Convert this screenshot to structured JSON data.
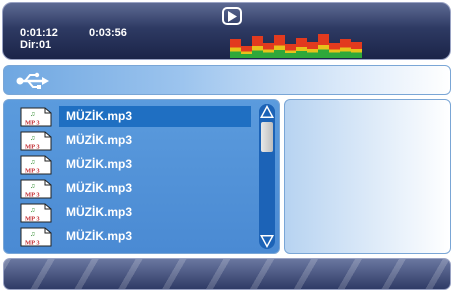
{
  "player": {
    "elapsed": "0:01:12",
    "total": "0:03:56",
    "dir": "Dir:01",
    "play_icon": "play-icon",
    "eq_levels": [
      0.7,
      0.45,
      0.8,
      0.55,
      0.85,
      0.5,
      0.75,
      0.6,
      0.9,
      0.55,
      0.7,
      0.6
    ]
  },
  "path_bar": {
    "icon": "usb-icon"
  },
  "file_list": {
    "items": [
      {
        "label": "MÜZİK.mp3",
        "icon": "mp3-file-icon",
        "icon_text": "MP 3",
        "selected": true
      },
      {
        "label": "MÜZİK.mp3",
        "icon": "mp3-file-icon",
        "icon_text": "MP 3",
        "selected": false
      },
      {
        "label": "MÜZİK.mp3",
        "icon": "mp3-file-icon",
        "icon_text": "MP 3",
        "selected": false
      },
      {
        "label": "MÜZİK.mp3",
        "icon": "mp3-file-icon",
        "icon_text": "MP 3",
        "selected": false
      },
      {
        "label": "MÜZİK.mp3",
        "icon": "mp3-file-icon",
        "icon_text": "MP 3",
        "selected": false
      },
      {
        "label": "MÜZİK.mp3",
        "icon": "mp3-file-icon",
        "icon_text": "MP 3",
        "selected": false
      }
    ]
  },
  "colors": {
    "selection": "#1f6fc2",
    "panel": "#4a8ad3",
    "header": "#2e3a63"
  }
}
